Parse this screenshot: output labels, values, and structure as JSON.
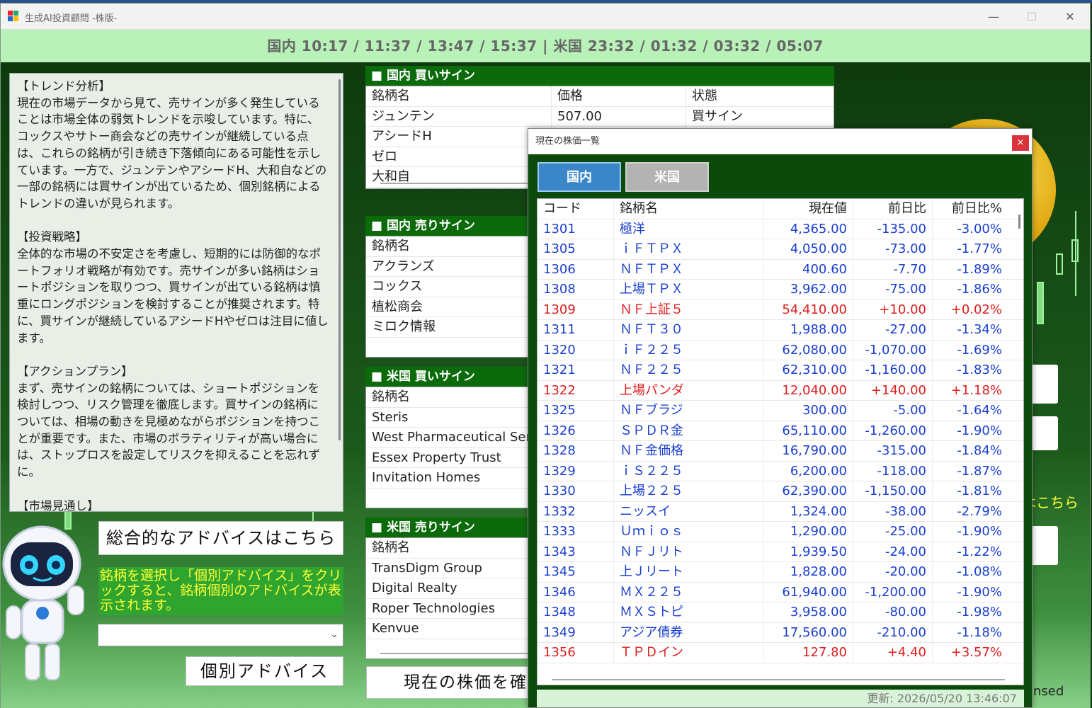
{
  "window": {
    "title": "生成AI投資顧問 -株版-",
    "controls": {
      "minimize": "—",
      "maximize": "☐",
      "close": "✕"
    }
  },
  "clock": {
    "text": "国内 10:17 / 11:37 / 13:47 / 15:37  |  米国 23:32 / 01:32 / 03:32 / 05:07"
  },
  "advice": {
    "text": "【トレンド分析】\n現在の市場データから見て、売サインが多く発生していることは市場全体の弱気トレンドを示唆しています。特に、コックスやサトー商会などの売サインが継続している点は、これらの銘柄が引き続き下落傾向にある可能性を示しています。一方で、ジュンテンやアシードH、大和自などの一部の銘柄には買サインが出ているため、個別銘柄によるトレンドの違いが見られます。\n\n【投資戦略】\n全体的な市場の不安定さを考慮し、短期的には防御的なポートフォリオ戦略が有効です。売サインが多い銘柄はショートポジションを取りつつ、買サインが出ている銘柄は慎重にロングポジションを検討することが推奨されます。特に、買サインが継続しているアシードHやゼロは注目に値します。\n\n【アクションプラン】\nまず、売サインの銘柄については、ショートポジションを検討しつつ、リスク管理を徹底します。買サインの銘柄については、相場の動きを見極めながらポジションを持つことが重要です。また、市場のボラティリティが高い場合には、ストップロスを設定してリスクを抑えることを忘れずに。\n\n【市場見通し】\n短期的には売り圧力が強い状況が続く可能性が高いですが、個別銘柄によっては買いのチャンスも存在します。市場"
  },
  "controls": {
    "overall_button": "総合的なアドバイスはこちら",
    "info_text": "銘柄を選択し「個別アドバイス」をクリックすると、銘柄個別のアドバイスが表示されます。",
    "individual_button": "個別アドバイス",
    "check_price_button": "現在の株価を確認",
    "combo_value": ""
  },
  "signals": {
    "domestic_buy": {
      "title": "■ 国内 買いサイン",
      "headers": [
        "銘柄名",
        "価格",
        "状態"
      ],
      "rows": [
        [
          "ジュンテン",
          "507.00",
          "買サイン"
        ],
        [
          "アシードH",
          "",
          ""
        ],
        [
          "ゼロ",
          "",
          ""
        ],
        [
          "大和自",
          "",
          ""
        ]
      ]
    },
    "domestic_sell": {
      "title": "■ 国内 売りサイン",
      "headers": [
        "銘柄名",
        "",
        ""
      ],
      "rows": [
        [
          "アクランズ"
        ],
        [
          "コックス"
        ],
        [
          "植松商会"
        ],
        [
          "ミロク情報"
        ]
      ]
    },
    "us_buy": {
      "title": "■ 米国 買いサイン",
      "headers": [
        "銘柄名",
        "",
        ""
      ],
      "rows": [
        [
          "Steris"
        ],
        [
          "West Pharmaceutical Services"
        ],
        [
          "Essex Property Trust"
        ],
        [
          "Invitation Homes"
        ]
      ]
    },
    "us_sell": {
      "title": "■ 米国 売りサイン",
      "headers": [
        "銘柄名",
        "",
        ""
      ],
      "rows": [
        [
          "TransDigm Group"
        ],
        [
          "Digital Realty"
        ],
        [
          "Roper Technologies"
        ],
        [
          "Kenvue"
        ]
      ]
    }
  },
  "right_side": {
    "fragment_text": "はこちら",
    "fragment_text2": "nsed"
  },
  "popup": {
    "title": "現在の株価一覧",
    "close": "×",
    "tabs": {
      "domestic": "国内",
      "us": "米国"
    },
    "headers": [
      "コード",
      "銘柄名",
      "現在値",
      "前日比",
      "前日比%"
    ],
    "rows": [
      [
        "1301",
        "極洋",
        "4,365.00",
        "-135.00",
        "-3.00%",
        "down"
      ],
      [
        "1305",
        "ｉＦＴＰＸ",
        "4,050.00",
        "-73.00",
        "-1.77%",
        "down"
      ],
      [
        "1306",
        "ＮＦＴＰＸ",
        "400.60",
        "-7.70",
        "-1.89%",
        "down"
      ],
      [
        "1308",
        "上場ＴＰＸ",
        "3,962.00",
        "-75.00",
        "-1.86%",
        "down"
      ],
      [
        "1309",
        "ＮＦ上証５",
        "54,410.00",
        "+10.00",
        "+0.02%",
        "up"
      ],
      [
        "1311",
        "ＮＦＴ３０",
        "1,988.00",
        "-27.00",
        "-1.34%",
        "down"
      ],
      [
        "1320",
        "ｉＦ２２５",
        "62,080.00",
        "-1,070.00",
        "-1.69%",
        "down"
      ],
      [
        "1321",
        "ＮＦ２２５",
        "62,310.00",
        "-1,160.00",
        "-1.83%",
        "down"
      ],
      [
        "1322",
        "上場パンダ",
        "12,040.00",
        "+140.00",
        "+1.18%",
        "up"
      ],
      [
        "1325",
        "ＮＦブラジ",
        "300.00",
        "-5.00",
        "-1.64%",
        "down"
      ],
      [
        "1326",
        "ＳＰＤＲ金",
        "65,110.00",
        "-1,260.00",
        "-1.90%",
        "down"
      ],
      [
        "1328",
        "ＮＦ金価格",
        "16,790.00",
        "-315.00",
        "-1.84%",
        "down"
      ],
      [
        "1329",
        "ｉＳ２２５",
        "6,200.00",
        "-118.00",
        "-1.87%",
        "down"
      ],
      [
        "1330",
        "上場２２５",
        "62,390.00",
        "-1,150.00",
        "-1.81%",
        "down"
      ],
      [
        "1332",
        "ニッスイ",
        "1,324.00",
        "-38.00",
        "-2.79%",
        "down"
      ],
      [
        "1333",
        "Ｕｍｉｏｓ",
        "1,290.00",
        "-25.00",
        "-1.90%",
        "down"
      ],
      [
        "1343",
        "ＮＦＪリト",
        "1,939.50",
        "-24.00",
        "-1.22%",
        "down"
      ],
      [
        "1345",
        "上Ｊリート",
        "1,828.00",
        "-20.00",
        "-1.08%",
        "down"
      ],
      [
        "1346",
        "ＭＸ２２５",
        "61,940.00",
        "-1,200.00",
        "-1.90%",
        "down"
      ],
      [
        "1348",
        "ＭＸＳトピ",
        "3,958.00",
        "-80.00",
        "-1.98%",
        "down"
      ],
      [
        "1349",
        "アジア債券",
        "17,560.00",
        "-210.00",
        "-1.18%",
        "down"
      ],
      [
        "1356",
        "ＴＰＤイン",
        "127.80",
        "+4.40",
        "+3.57%",
        "up"
      ]
    ],
    "status": "更新: 2026/05/20 13:46:07"
  },
  "colors": {
    "up": "#e01c1c",
    "down": "#1a3fcf",
    "header_green": "#0b6b0b",
    "clock_bg": "#b8f2b8",
    "tab_active": "#3a86c9"
  }
}
